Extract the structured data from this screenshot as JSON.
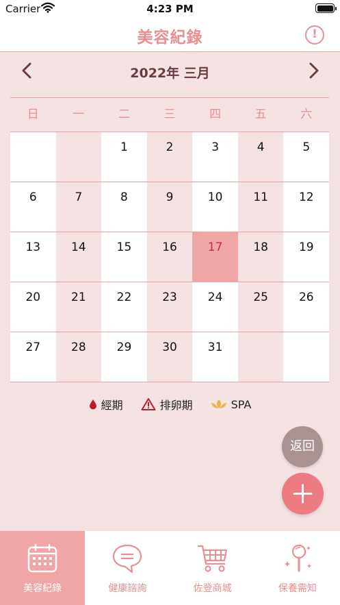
{
  "status_bar": {
    "carrier": "Carrier",
    "time": "4:23 PM"
  },
  "nav": {
    "title": "美容紀錄"
  },
  "calendar": {
    "month_title": "2022年  三月",
    "weekdays": [
      "日",
      "一",
      "二",
      "三",
      "四",
      "五",
      "六"
    ],
    "weeks": [
      [
        "",
        "",
        "1",
        "2",
        "3",
        "4",
        "5"
      ],
      [
        "6",
        "7",
        "8",
        "9",
        "10",
        "11",
        "12"
      ],
      [
        "13",
        "14",
        "15",
        "16",
        "17",
        "18",
        "19"
      ],
      [
        "20",
        "21",
        "22",
        "23",
        "24",
        "25",
        "26"
      ],
      [
        "27",
        "28",
        "29",
        "30",
        "31",
        "",
        ""
      ]
    ],
    "today": "17"
  },
  "legend": {
    "period": "經期",
    "ovulation": "排卵期",
    "spa": "SPA"
  },
  "buttons": {
    "back": "返回"
  },
  "tabs": [
    {
      "label": "美容紀錄",
      "icon": "calendar-icon"
    },
    {
      "label": "健康諮詢",
      "icon": "chat-icon"
    },
    {
      "label": "佐登商城",
      "icon": "cart-icon"
    },
    {
      "label": "保養需知",
      "icon": "mirror-icon"
    }
  ],
  "colors": {
    "accent": "#e88f92",
    "today": "#f0a6a7",
    "period": "#b81d2a",
    "spa": "#e8b24a"
  }
}
